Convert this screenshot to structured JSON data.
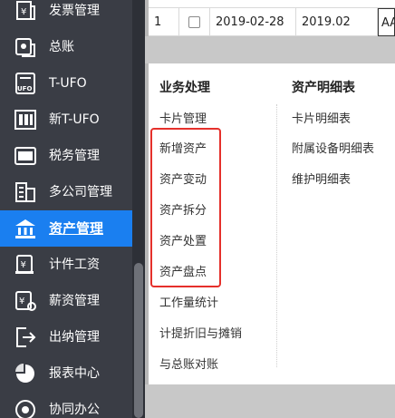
{
  "sidebar": {
    "items": [
      {
        "label": "发票管理",
        "icon": "invoice-icon",
        "active": false
      },
      {
        "label": "总账",
        "icon": "ledger-icon",
        "active": false
      },
      {
        "label": "T-UFO",
        "icon": "ufo-icon",
        "active": false
      },
      {
        "label": "新T-UFO",
        "icon": "new-ufo-icon",
        "active": false
      },
      {
        "label": "税务管理",
        "icon": "tax-icon",
        "active": false
      },
      {
        "label": "多公司管理",
        "icon": "multi-company-icon",
        "active": false
      },
      {
        "label": "资产管理",
        "icon": "bank-icon",
        "active": true
      },
      {
        "label": "计件工资",
        "icon": "piecework-icon",
        "active": false
      },
      {
        "label": "薪资管理",
        "icon": "payroll-icon",
        "active": false
      },
      {
        "label": "出纳管理",
        "icon": "cashier-icon",
        "active": false
      },
      {
        "label": "报表中心",
        "icon": "report-icon",
        "active": false
      },
      {
        "label": "协同办公",
        "icon": "collab-icon",
        "active": false
      }
    ]
  },
  "table": {
    "row": {
      "index": "1",
      "date": "2019-02-28",
      "period": "2019.02",
      "extra": "AA"
    }
  },
  "menu": {
    "business": {
      "title": "业务处理",
      "items": [
        "卡片管理",
        "新增资产",
        "资产变动",
        "资产拆分",
        "资产处置",
        "资产盘点",
        "工作量统计",
        "计提折旧与摊销",
        "与总账对账"
      ]
    },
    "details": {
      "title": "资产明细表",
      "items": [
        "卡片明细表",
        "附属设备明细表",
        "维护明细表"
      ]
    }
  },
  "colors": {
    "sidebar_bg": "#3a3d45",
    "active_bg": "#1a7ff0",
    "highlight_border": "#e5302b"
  }
}
